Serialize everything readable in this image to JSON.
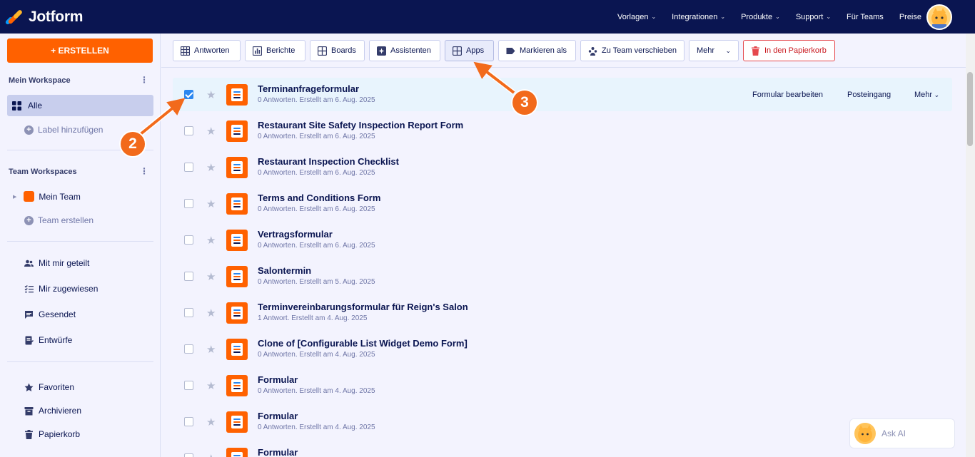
{
  "brand": {
    "name": "Jotform"
  },
  "nav": {
    "links": [
      "Vorlagen",
      "Integrationen",
      "Produkte",
      "Support",
      "Für Teams",
      "Preise"
    ],
    "has_dropdown": [
      true,
      true,
      true,
      true,
      false,
      false
    ]
  },
  "sidebar": {
    "create_label": "+ ERSTELLEN",
    "my_workspace_title": "Mein Workspace",
    "all_label": "Alle",
    "add_label": "Label hinzufügen",
    "team_workspaces_title": "Team Workspaces",
    "my_team": "Mein Team",
    "create_team": "Team erstellen",
    "links": [
      "Mit mir geteilt",
      "Mir zugewiesen",
      "Gesendet",
      "Entwürfe"
    ],
    "links2": [
      "Favoriten",
      "Archivieren",
      "Papierkorb"
    ]
  },
  "toolbar": {
    "buttons": [
      "Antworten",
      "Berichte",
      "Boards",
      "Assistenten",
      "Apps",
      "Markieren als",
      "Zu Team verschieben",
      "Mehr",
      "In den Papierkorb"
    ]
  },
  "forms": [
    {
      "title": "Terminanfrageformular",
      "meta": "0 Antworten. Erstellt am 6. Aug. 2025",
      "checked": true
    },
    {
      "title": "Restaurant Site Safety Inspection Report Form",
      "meta": "0 Antworten. Erstellt am 6. Aug. 2025",
      "checked": false
    },
    {
      "title": "Restaurant Inspection Checklist",
      "meta": "0 Antworten. Erstellt am 6. Aug. 2025",
      "checked": false
    },
    {
      "title": "Terms and Conditions Form",
      "meta": "0 Antworten. Erstellt am 6. Aug. 2025",
      "checked": false
    },
    {
      "title": "Vertragsformular",
      "meta": "0 Antworten. Erstellt am 6. Aug. 2025",
      "checked": false
    },
    {
      "title": "Salontermin",
      "meta": "0 Antworten. Erstellt am 5. Aug. 2025",
      "checked": false
    },
    {
      "title": "Terminvereinbarungsformular für Reign's Salon",
      "meta": "1 Antwort. Erstellt am 4. Aug. 2025",
      "checked": false
    },
    {
      "title": "Clone of [Configurable List Widget Demo Form]",
      "meta": "0 Antworten. Erstellt am 4. Aug. 2025",
      "checked": false
    },
    {
      "title": "Formular",
      "meta": "0 Antworten. Erstellt am 4. Aug. 2025",
      "checked": false
    },
    {
      "title": "Formular",
      "meta": "0 Antworten. Erstellt am 4. Aug. 2025",
      "checked": false
    },
    {
      "title": "Formular",
      "meta": "",
      "checked": false
    }
  ],
  "row_actions": {
    "edit": "Formular bearbeiten",
    "inbox": "Posteingang",
    "more": "Mehr"
  },
  "annotations": [
    "2",
    "3"
  ],
  "ask_ai": "Ask AI",
  "colors": {
    "nav_bg": "#0a1551",
    "accent": "#ff6100",
    "selected_row": "#e8f4fd",
    "annotation": "#f26a1b"
  }
}
